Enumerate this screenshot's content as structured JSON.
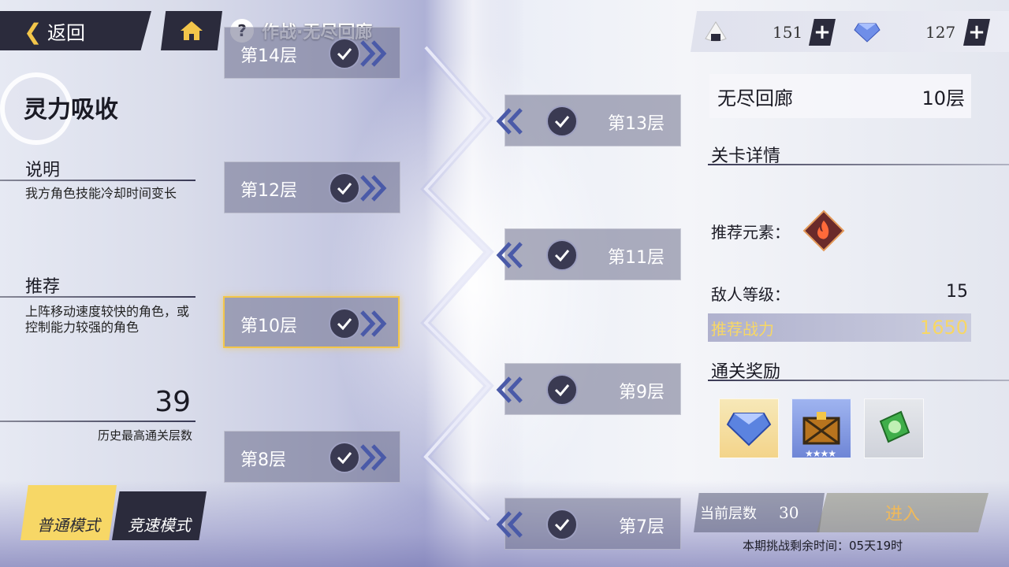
{
  "header": {
    "back_label": "返回",
    "title": "作战·无尽回廊",
    "help_symbol": "?",
    "icons": {
      "back": "chevron-left-icon",
      "home": "home-icon",
      "help": "help-icon"
    }
  },
  "resources": [
    {
      "name": "rice-ball",
      "value": "151",
      "icon": "rice-ball-icon"
    },
    {
      "name": "crystal",
      "value": "127",
      "icon": "crystal-icon"
    }
  ],
  "left_panel": {
    "buff_title": "灵力吸收",
    "description_heading": "说明",
    "description_text": "我方角色技能冷却时间变长",
    "recommend_heading": "推荐",
    "recommend_text": "上阵移动速度较快的角色，或控制能力较强的角色",
    "best_floor": "39",
    "best_floor_label": "历史最高通关层数"
  },
  "modes": {
    "normal_label": "普通模式",
    "speed_label": "竞速模式",
    "selected": "normal"
  },
  "floors": [
    {
      "label": "第14层",
      "side": "left",
      "cleared": true
    },
    {
      "label": "第13层",
      "side": "right",
      "cleared": true
    },
    {
      "label": "第12层",
      "side": "left",
      "cleared": true
    },
    {
      "label": "第11层",
      "side": "right",
      "cleared": true
    },
    {
      "label": "第10层",
      "side": "left",
      "cleared": true,
      "selected": true
    },
    {
      "label": "第9层",
      "side": "right",
      "cleared": true
    },
    {
      "label": "第8层",
      "side": "left",
      "cleared": true
    },
    {
      "label": "第7层",
      "side": "right",
      "cleared": true
    }
  ],
  "detail": {
    "dungeon_name": "无尽回廊",
    "level": "10层",
    "section_heading": "关卡详情",
    "element_label": "推荐元素：",
    "element_icon": "fire-element-icon",
    "enemy_level_label": "敌人等级：",
    "enemy_level": "15",
    "power_label": "推荐战力",
    "power_value": "1650",
    "reward_heading": "通关奖励",
    "rewards": [
      {
        "icon": "crystal-reward-icon"
      },
      {
        "icon": "treasure-chest-icon",
        "stars": "★★★★"
      },
      {
        "icon": "exp-book-icon"
      }
    ]
  },
  "footer": {
    "current_floor_label": "当前层数",
    "current_floor": "30",
    "enter_label": "进入",
    "remaining_time": "本期挑战剩余时间：05天19时"
  },
  "colors": {
    "accent_yellow": "#f3c64a",
    "dark_panel": "#2b2b3c",
    "power_gold": "#f7d766"
  }
}
